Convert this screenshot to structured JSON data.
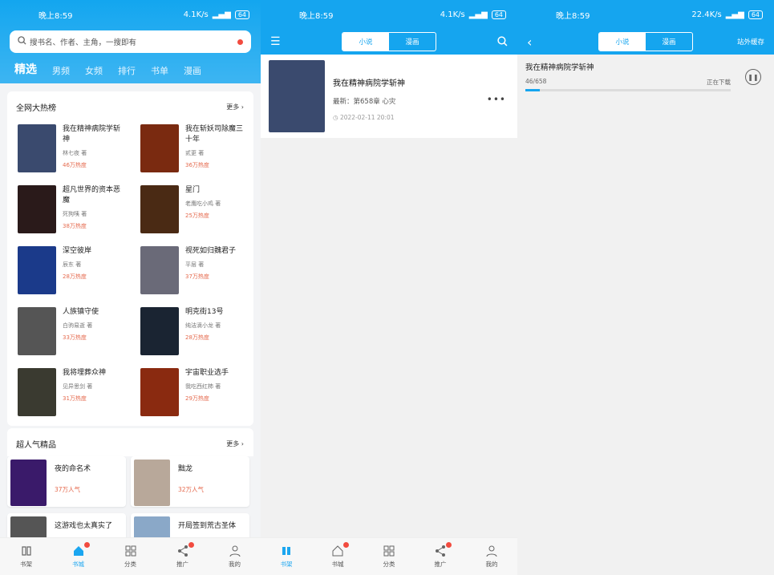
{
  "status": {
    "time": "晚上8:59",
    "speed1": "4.1K/s",
    "speed2": "4.1K/s",
    "speed3": "22.4K/s",
    "battery": "64"
  },
  "home": {
    "search_placeholder": "搜书名、作者、主角，一搜即有",
    "tabs": [
      "精选",
      "男频",
      "女频",
      "排行",
      "书单",
      "漫画"
    ],
    "hot_title": "全网大热榜",
    "more": "更多",
    "hot_books": [
      {
        "title": "我在精神病院学斩神",
        "author": "林七夜 著",
        "heat": "46万热度",
        "color": "#3a4a6e"
      },
      {
        "title": "我在斩妖司除魔三十年",
        "author": "贰更 著",
        "heat": "36万热度",
        "color": "#7a2a10"
      },
      {
        "title": "超凡世界的资本恶魔",
        "author": "死狗咦 著",
        "heat": "38万热度",
        "color": "#2a1a1a"
      },
      {
        "title": "星门",
        "author": "老鹰吃小鸡 著",
        "heat": "25万热度",
        "color": "#4a2a14"
      },
      {
        "title": "深空彼岸",
        "author": "辰东 著",
        "heat": "28万热度",
        "color": "#1b3a8a"
      },
      {
        "title": "视死如归魏君子",
        "author": "平层 著",
        "heat": "37万热度",
        "color": "#6a6a78"
      },
      {
        "title": "人族镇守使",
        "author": "白驹易逝 著",
        "heat": "33万热度",
        "color": "#555555"
      },
      {
        "title": "明克街13号",
        "author": "纯洁滴小龙 著",
        "heat": "28万热度",
        "color": "#1a2432"
      },
      {
        "title": "我将埋葬众神",
        "author": "见异思剑 著",
        "heat": "31万热度",
        "color": "#3a3a30"
      },
      {
        "title": "宇宙职业选手",
        "author": "我吃西红柿 著",
        "heat": "29万热度",
        "color": "#8a2a10"
      }
    ],
    "pop_title": "超人气精品",
    "pop_books": [
      {
        "title": "夜的命名术",
        "heat": "37万人气",
        "color": "#3a1a6a"
      },
      {
        "title": "黜龙",
        "heat": "32万人气",
        "color": "#b8a89a"
      },
      {
        "title": "这游戏也太真实了",
        "heat": "",
        "color": "#555555"
      },
      {
        "title": "开局签到荒古圣体",
        "heat": "",
        "color": "#8aa8c8"
      }
    ]
  },
  "nav": [
    "书架",
    "书城",
    "分类",
    "推广",
    "我的"
  ],
  "shelf": {
    "seg": [
      "小说",
      "漫画"
    ],
    "book_title": "我在精神病院学斩神",
    "latest": "最新：第658章 心灾",
    "date": "2022-02-11 20:01",
    "cover_color": "#3a4a6e"
  },
  "cache": {
    "header_right": "站外缓存",
    "book_title": "我在精神病院学斩神",
    "progress_text": "46/658",
    "progress": 0.07,
    "state": "正在下载"
  }
}
